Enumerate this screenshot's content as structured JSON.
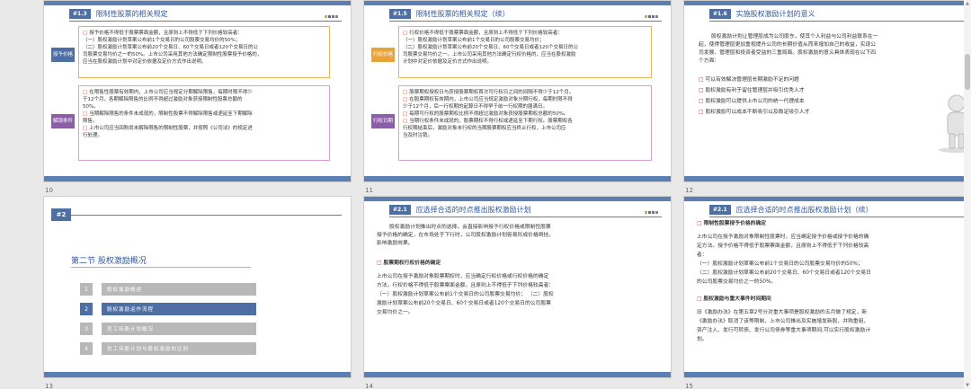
{
  "slides": [
    {
      "num": "10",
      "tag": "#1.3",
      "title": "限制性股票的相关规定",
      "label1": "授予价格",
      "label2": "解锁条件",
      "box1": [
        "授予价格不得低于股票票面金额，且原则上不得低于下列价格较高者：",
        "（一）股权激励计划草案公布前1个交易日的公司股票交易均价的50%；",
        "（二）股权激励计划草案公布前20个交易日、60个交易日或者120个交易日的公",
        "司股票交易均价之一的50%。上市公司采用其他方法确定限制性股票授予价格的，",
        "应当在股权激励计划中对定价依据及定价方式作出说明。"
      ],
      "box2": [
        "在限售性股票有效期内，上市公司应当规定分期解除限售，每期时限不得少",
        "于12个月，各期解除限售的比例不得超过激励对象获授限制性股票总额的",
        "50%。",
        "当期解除限售的条件未成就的，限制性股票不得解除限售或递延至下期解除",
        "限售。",
        "上市公司应当回购尚未解除限售的限制性股票，并按照《公司法》的规定进",
        "行处理。"
      ]
    },
    {
      "num": "11",
      "tag": "#1.5",
      "title": "限制性股票的相关规定（续）",
      "label1": "行权价格",
      "label2": "行权日期",
      "box1": [
        "行权价格不得低于股票票面金额，且原则上不得低于下列价格较高者：",
        "（一）股权激励计划草案公布前1个交易日的公司股票交易均价；",
        "（二）股权激励计划草案公布前20个交易日、60个交易日或者120个交易日的公",
        "司股票交易均价之一。上市公司采用其他方法确定行权价格的，应当在股权激励",
        "计划中对定价依据及定价方式作出说明。"
      ],
      "box2": [
        "股票期权授权日与获授股票期权首次可行权日之间的间隔不得少于12个月。",
        "在股票期权有效期内，上市公司应当规定激励对象分期行权，每期时限不得",
        "少于12个月，后一行权期的起算日不得早于前一行权期的届满日。",
        "每期可行权的股票期权比例不得超过激励对象获授股票期权总额的50%。",
        "当期行权条件未成就的，股票期权不得行权或递延至下期行权。股票期权各",
        "行权期结束后，激励对象未行权的当期股票期权应当终止行权，上市公司应",
        "当及时注销。"
      ]
    },
    {
      "num": "12",
      "tag": "#1.6",
      "title": "实施股权激励计划的意义",
      "para": [
        "股权激励计划让管理层成为公司股东，使其个人利益与公司利益联系在一",
        "起，使得管理层更加重视提升公司的长期价值从而来增加自己的收益，实现公",
        "司发展、管理层和投资者受益的三重局面。股权激励的意义具体表现在以下四",
        "个方面："
      ],
      "bullets": [
        "可以有效解决管理层长期激励不足的问题",
        "股权激励有利于留住管理层并吸引优秀人才",
        "股权激励可以提供上市公司的统一代理成本",
        "股权激励可以成本不断吸引以及稳定吸引人才"
      ]
    },
    {
      "num": "13",
      "tag": "#2",
      "title": "第二节  股权激励概况",
      "menu": [
        {
          "n": "1",
          "label": "股权激励概述"
        },
        {
          "n": "2",
          "label": "股权激励运作流程"
        },
        {
          "n": "3",
          "label": "员工持股计划概况"
        },
        {
          "n": "4",
          "label": "员工持股计划与股权激励的区别"
        }
      ]
    },
    {
      "num": "14",
      "tag": "#2.1",
      "title": "应选择合适的时点推出股权激励计划",
      "para1": [
        "股权激励计划推出时点的选择，会直接影响授予行权价格或限制性股票",
        "授予价格的确定，在市场处于下行时，公司股权激励计划容易形成价格倒挂，",
        "影响激励效果。"
      ],
      "sub1": "股票期权行权价格的确定",
      "para2": [
        "上市公司在授予激励对象股票期权时，应当确定行权价格或行权价格的确定",
        "方法。行权价格不得低于股票票面金额，且原则上不得低于下列价格较高者：",
        "（一）股权激励计划草案公布前1个交易日的公司股票交易均价；  （二）股权",
        "激励计划草案公布前20个交易日、60个交易日或者120个交易日的公司股票",
        "交易均价之一。"
      ]
    },
    {
      "num": "15",
      "tag": "#2.1",
      "title": "应选择合适的时点推出股权激励计划（续）",
      "sub1": "限制性股票授予价格的确定",
      "para1": [
        "上市公司在授予激励对象限制性股票时，应当确定授予价格或授予价格的确",
        "定方法。授予价格不得低于股票票面金额，且原则上不得低于下列价格较高",
        "者：",
        "（一）股权激励计划草案公布前1个交易日的公司股票交易均价的50%；",
        "（二）股权激励计划草案公布前20个交易日、60个交易日或者120个交易日",
        "的公司股票交易均价之一的50%。"
      ],
      "sub2": "股权激励与重大事件时间期间",
      "para2": [
        "旧《激励办法》在第五章2号分对重大事项是股权激励的五月做了规定，新",
        "《激励办法》取消了该等限制，上市公司推出及实施增发新股、并购重组、",
        "资产注入、发行可转债、发行公司债券等重大事项期间,可以实行股权激励计",
        "划。"
      ]
    }
  ],
  "colors": {
    "accent": "#4e6fa3",
    "orange": "#e8a33a",
    "purple": "#8b5fa8",
    "red": "#c0392b"
  }
}
